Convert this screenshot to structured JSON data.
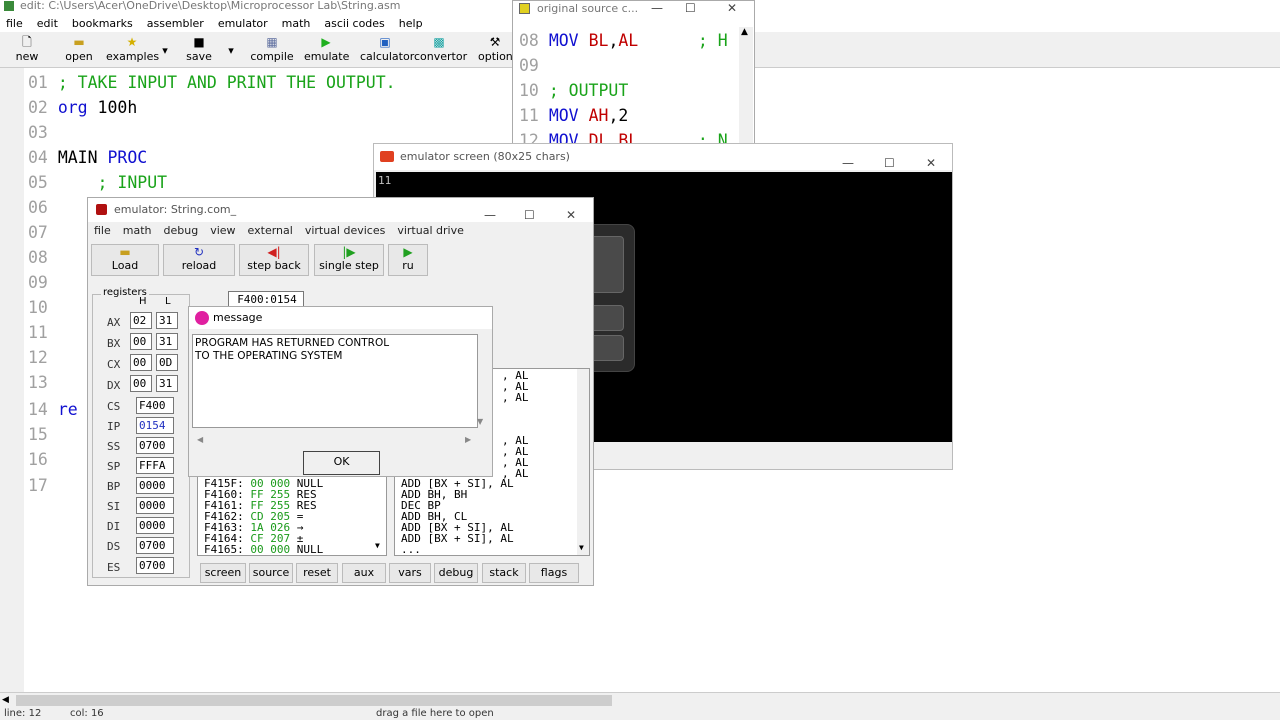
{
  "editor": {
    "title": "edit: C:\\Users\\Acer\\OneDrive\\Desktop\\Microprocessor Lab\\String.asm",
    "menu": [
      "file",
      "edit",
      "bookmarks",
      "assembler",
      "emulator",
      "math",
      "ascii codes",
      "help"
    ],
    "toolbar": [
      {
        "label": "new"
      },
      {
        "label": "open"
      },
      {
        "label": "examples"
      },
      {
        "label": "save"
      },
      {
        "label": "compile"
      },
      {
        "label": "emulate"
      },
      {
        "label": "calculator"
      },
      {
        "label": "convertor"
      },
      {
        "label": "option"
      }
    ],
    "lines": [
      {
        "num": "01",
        "code": "; TAKE INPUT AND PRINT THE OUTPUT."
      },
      {
        "num": "02",
        "code_a": "org",
        "code_b": " 100h"
      },
      {
        "num": "03"
      },
      {
        "num": "04",
        "code_a": "MAIN",
        "code_b": "PROC"
      },
      {
        "num": "05",
        "code": "; INPUT"
      },
      {
        "num": "06"
      },
      {
        "num": "07"
      },
      {
        "num": "08"
      },
      {
        "num": "09"
      },
      {
        "num": "10"
      },
      {
        "num": "11"
      },
      {
        "num": "12"
      },
      {
        "num": "13"
      },
      {
        "num": "14",
        "code": "re"
      },
      {
        "num": "15"
      },
      {
        "num": "16"
      },
      {
        "num": "17"
      }
    ],
    "status": {
      "line": "line: 12",
      "col": "col: 16",
      "hint": "drag a file here to open"
    }
  },
  "source_window": {
    "title": "original source c...",
    "lines": [
      {
        "num": "08",
        "op": "MOV",
        "a": "BL",
        "b": "AL",
        "cmt": "; H"
      },
      {
        "num": "09"
      },
      {
        "num": "10",
        "cmt": "; OUTPUT"
      },
      {
        "num": "11",
        "op": "MOV",
        "a": "AH",
        "b": "2"
      },
      {
        "num": "12",
        "op": "MOV",
        "a": "DL",
        "b": "BL",
        "cmt": "; N"
      }
    ]
  },
  "screen_window": {
    "title": "emulator screen (80x25 chars)",
    "output": "11"
  },
  "emulator": {
    "title": "emulator: String.com_",
    "menu": [
      "file",
      "math",
      "debug",
      "view",
      "external",
      "virtual devices",
      "virtual drive"
    ],
    "toolbar": [
      {
        "label": "Load"
      },
      {
        "label": "reload"
      },
      {
        "label": "step back"
      },
      {
        "label": "single step"
      },
      {
        "label": "ru"
      }
    ],
    "address": "F400:0154",
    "registers_label": "registers",
    "h_label": "H",
    "l_label": "L",
    "regs_hl": [
      {
        "name": "AX",
        "h": "02",
        "l": "31"
      },
      {
        "name": "BX",
        "h": "00",
        "l": "31"
      },
      {
        "name": "CX",
        "h": "00",
        "l": "0D"
      },
      {
        "name": "DX",
        "h": "00",
        "l": "31"
      }
    ],
    "regs_16": [
      {
        "name": "CS",
        "v": "F400"
      },
      {
        "name": "IP",
        "v": "0154"
      },
      {
        "name": "SS",
        "v": "0700"
      },
      {
        "name": "SP",
        "v": "FFFA"
      },
      {
        "name": "BP",
        "v": "0000"
      },
      {
        "name": "SI",
        "v": "0000"
      },
      {
        "name": "DI",
        "v": "0000"
      },
      {
        "name": "DS",
        "v": "0700"
      },
      {
        "name": "ES",
        "v": "0700"
      }
    ],
    "memory": [
      {
        "addr": "F415F:",
        "hex": "00 000",
        "ch": "NULL"
      },
      {
        "addr": "F4160:",
        "hex": "FF 255",
        "ch": "RES"
      },
      {
        "addr": "F4161:",
        "hex": "FF 255",
        "ch": "RES"
      },
      {
        "addr": "F4162:",
        "hex": "CD 205",
        "ch": "="
      },
      {
        "addr": "F4163:",
        "hex": "1A 026",
        "ch": "→"
      },
      {
        "addr": "F4164:",
        "hex": "CF 207",
        "ch": "±"
      },
      {
        "addr": "F4165:",
        "hex": "00 000",
        "ch": "NULL"
      }
    ],
    "disasm_top": [
      ", AL",
      ", AL",
      ", AL"
    ],
    "disasm_mid": [
      ", AL",
      ", AL",
      ", AL",
      ", AL"
    ],
    "disasm": [
      "ADD [BX + SI], AL",
      "ADD BH, BH",
      "DEC BP",
      "ADD BH, CL",
      "ADD [BX + SI], AL",
      "ADD [BX + SI], AL",
      "..."
    ],
    "bottom_buttons": [
      "screen",
      "source",
      "reset",
      "aux",
      "vars",
      "debug",
      "stack",
      "flags"
    ]
  },
  "message": {
    "title": "message",
    "text_1": "PROGRAM HAS RETURNED CONTROL",
    "text_2": "TO THE OPERATING SYSTEM",
    "ok": "OK"
  }
}
